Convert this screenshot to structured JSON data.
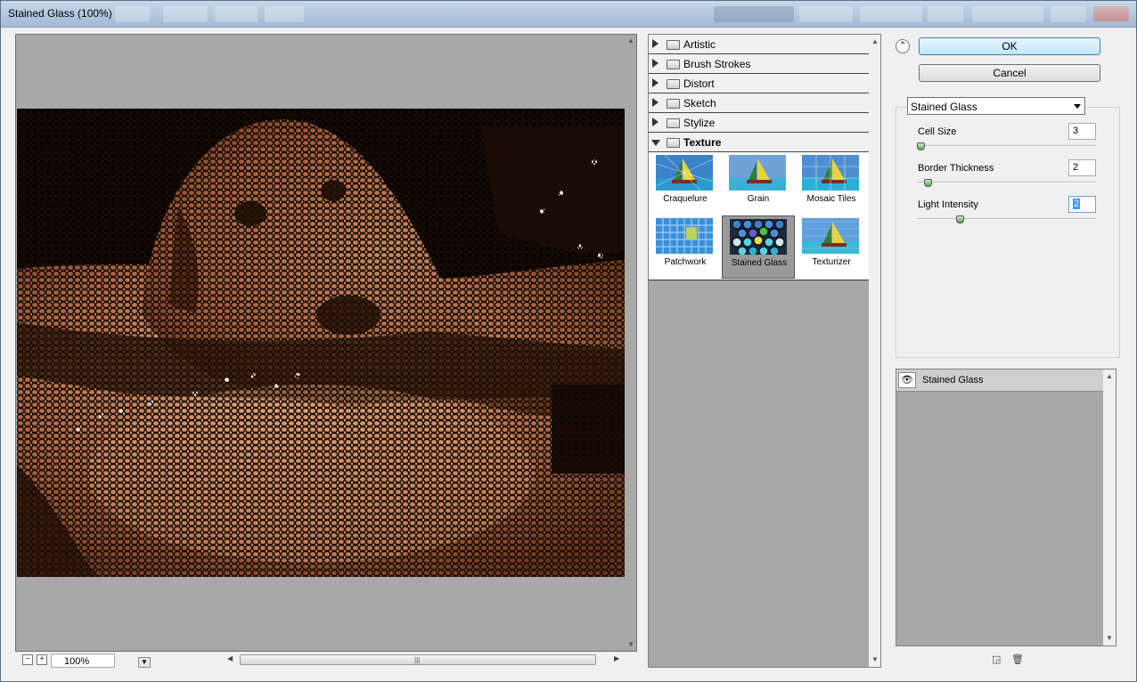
{
  "window": {
    "title": "Stained Glass (100%)"
  },
  "preview": {
    "zoom": "100%"
  },
  "categories": [
    {
      "label": "Artistic",
      "expanded": false
    },
    {
      "label": "Brush Strokes",
      "expanded": false
    },
    {
      "label": "Distort",
      "expanded": false
    },
    {
      "label": "Sketch",
      "expanded": false
    },
    {
      "label": "Stylize",
      "expanded": false
    },
    {
      "label": "Texture",
      "expanded": true
    }
  ],
  "texture_filters": [
    {
      "label": "Craquelure",
      "selected": false
    },
    {
      "label": "Grain",
      "selected": false
    },
    {
      "label": "Mosaic Tiles",
      "selected": false
    },
    {
      "label": "Patchwork",
      "selected": false
    },
    {
      "label": "Stained Glass",
      "selected": true
    },
    {
      "label": "Texturizer",
      "selected": false
    }
  ],
  "buttons": {
    "ok": "OK",
    "cancel": "Cancel"
  },
  "filter_select": {
    "value": "Stained Glass"
  },
  "params": [
    {
      "label": "Cell Size",
      "value": "3",
      "slider": 0.03
    },
    {
      "label": "Border Thickness",
      "value": "2",
      "slider": 0.08
    },
    {
      "label": "Light Intensity",
      "value": "2",
      "slider": 0.24
    }
  ],
  "layers": [
    {
      "label": "Stained Glass",
      "visible": true
    }
  ],
  "colors": {
    "accent": "#3399ff",
    "canvas_gray": "#a8a8a8"
  }
}
